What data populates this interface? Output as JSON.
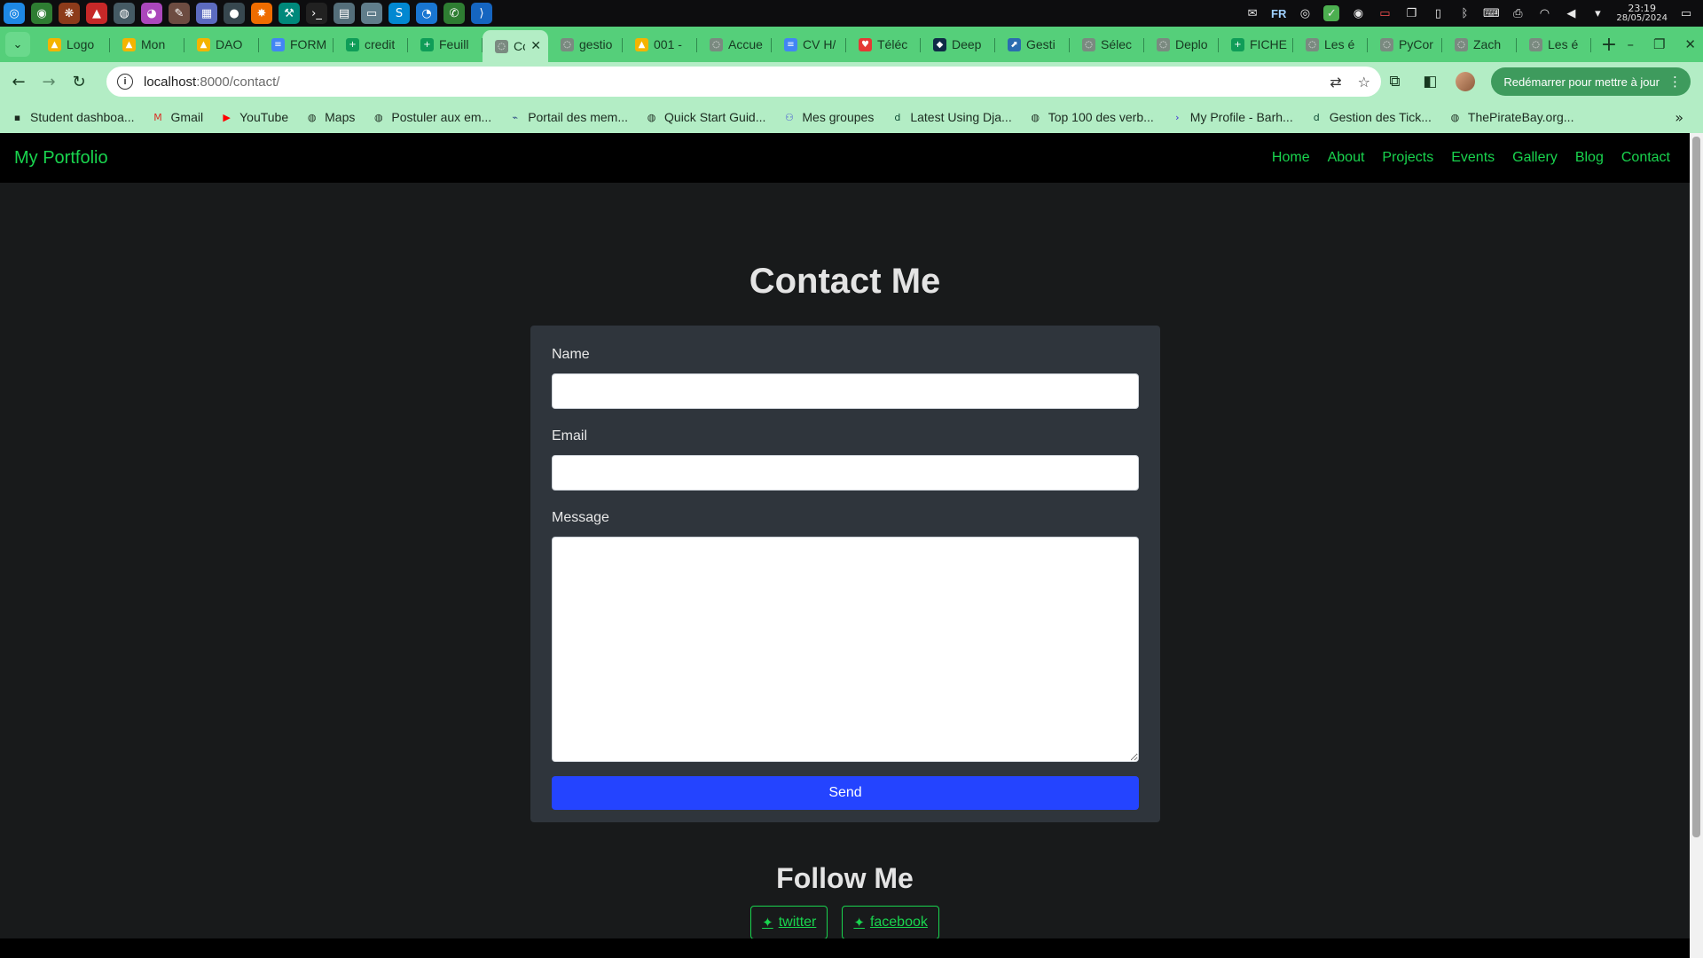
{
  "os_bar": {
    "apps": [
      {
        "name": "settings-app-icon",
        "glyph": "◎",
        "color": "#1e88e5"
      },
      {
        "name": "chrome-app-icon",
        "glyph": "◉",
        "color": "#2e7d32"
      },
      {
        "name": "leaf-app-icon",
        "glyph": "❋",
        "color": "#8d3b1a"
      },
      {
        "name": "triangle-app-icon",
        "glyph": "▲",
        "color": "#c62828"
      },
      {
        "name": "chromium-app-icon",
        "glyph": "◍",
        "color": "#455a64"
      },
      {
        "name": "color-picker-app-icon",
        "glyph": "◕",
        "color": "#ab47bc"
      },
      {
        "name": "gimp-app-icon",
        "glyph": "✎",
        "color": "#6d4c41"
      },
      {
        "name": "calculator-app-icon",
        "glyph": "▦",
        "color": "#5c6bc0"
      },
      {
        "name": "disc-app-icon",
        "glyph": "●",
        "color": "#37474f"
      },
      {
        "name": "pinwheel-app-icon",
        "glyph": "✸",
        "color": "#ef6c00"
      },
      {
        "name": "tools-app-icon",
        "glyph": "⚒",
        "color": "#00897b"
      },
      {
        "name": "terminal-app-icon",
        "glyph": "›_",
        "color": "#212121"
      },
      {
        "name": "system-monitor-app-icon",
        "glyph": "▤",
        "color": "#546e7a"
      },
      {
        "name": "files-app-icon",
        "glyph": "▭",
        "color": "#607d8b"
      },
      {
        "name": "skype-app-icon",
        "glyph": "S",
        "color": "#0288d1"
      },
      {
        "name": "messenger-app-icon",
        "glyph": "◔",
        "color": "#1976d2"
      },
      {
        "name": "whatsapp-app-icon",
        "glyph": "✆",
        "color": "#2e7d32"
      },
      {
        "name": "vscode-app-icon",
        "glyph": "⟩",
        "color": "#1565c0"
      }
    ],
    "tray": {
      "lang": "FR",
      "time": "23:19",
      "date": "28/05/2024"
    }
  },
  "tabs": [
    {
      "title": "Logo",
      "icon": "google-drive-icon",
      "color": "#f4b400",
      "glyph": "▲"
    },
    {
      "title": "Mon",
      "icon": "google-drive-icon",
      "color": "#f4b400",
      "glyph": "▲"
    },
    {
      "title": "DAO",
      "icon": "google-drive-icon",
      "color": "#f4b400",
      "glyph": "▲"
    },
    {
      "title": "FORM",
      "icon": "google-docs-icon",
      "color": "#4285f4",
      "glyph": "≡"
    },
    {
      "title": "credit",
      "icon": "google-sheets-icon",
      "color": "#0f9d58",
      "glyph": "+"
    },
    {
      "title": "Feuill",
      "icon": "google-sheets-icon",
      "color": "#0f9d58",
      "glyph": "+"
    },
    {
      "title": "Co",
      "icon": "globe-icon",
      "color": "#7a8a80",
      "glyph": "◌",
      "active": true
    },
    {
      "title": "gestio",
      "icon": "globe-icon",
      "color": "#7a8a80",
      "glyph": "◌"
    },
    {
      "title": "001 -",
      "icon": "google-drive-icon",
      "color": "#f4b400",
      "glyph": "▲"
    },
    {
      "title": "Accue",
      "icon": "globe-icon",
      "color": "#7a8a80",
      "glyph": "◌"
    },
    {
      "title": "CV H/",
      "icon": "google-docs-icon",
      "color": "#4285f4",
      "glyph": "≡"
    },
    {
      "title": "Téléc",
      "icon": "heart-icon",
      "color": "#e53935",
      "glyph": "♥"
    },
    {
      "title": "Deep",
      "icon": "deepl-icon",
      "color": "#0f2b46",
      "glyph": "◆"
    },
    {
      "title": "Gesti",
      "icon": "link-icon",
      "color": "#2b6cb0",
      "glyph": "⬈"
    },
    {
      "title": "Sélec",
      "icon": "globe-icon",
      "color": "#7a8a80",
      "glyph": "◌"
    },
    {
      "title": "Deplo",
      "icon": "globe-icon",
      "color": "#7a8a80",
      "glyph": "◌"
    },
    {
      "title": "FICHE",
      "icon": "google-sheets-icon",
      "color": "#0f9d58",
      "glyph": "+"
    },
    {
      "title": "Les é",
      "icon": "globe-icon",
      "color": "#7a8a80",
      "glyph": "◌"
    },
    {
      "title": "PyCor",
      "icon": "globe-icon",
      "color": "#7a8a80",
      "glyph": "◌"
    },
    {
      "title": "Zach",
      "icon": "globe-icon",
      "color": "#7a8a80",
      "glyph": "◌"
    },
    {
      "title": "Les é",
      "icon": "globe-icon",
      "color": "#7a8a80",
      "glyph": "◌"
    }
  ],
  "toolbar": {
    "url_host": "localhost",
    "url_rest": ":8000/contact/",
    "update_label": "Redémarrer pour mettre à jour"
  },
  "bookmarks": [
    {
      "label": "Student dashboa...",
      "icon": "alx-icon",
      "glyph": "▪",
      "color": "#1c2b20"
    },
    {
      "label": "Gmail",
      "icon": "gmail-icon",
      "glyph": "M",
      "color": "#d93025"
    },
    {
      "label": "YouTube",
      "icon": "youtube-icon",
      "glyph": "▶",
      "color": "#ff0000"
    },
    {
      "label": "Maps",
      "icon": "globe-icon",
      "glyph": "◍",
      "color": "#1c2b20"
    },
    {
      "label": "Postuler aux em...",
      "icon": "globe-icon",
      "glyph": "◍",
      "color": "#1c2b20"
    },
    {
      "label": "Portail des mem...",
      "icon": "portal-icon",
      "glyph": "⌁",
      "color": "#3a5a8c"
    },
    {
      "label": "Quick Start Guid...",
      "icon": "globe-icon",
      "glyph": "◍",
      "color": "#1c2b20"
    },
    {
      "label": "Mes groupes",
      "icon": "groups-icon",
      "glyph": "⚇",
      "color": "#4a5bd4"
    },
    {
      "label": "Latest Using Dja...",
      "icon": "django-icon",
      "glyph": "d",
      "color": "#0c4b33"
    },
    {
      "label": "Top 100 des verb...",
      "icon": "globe-icon",
      "glyph": "◍",
      "color": "#1c2b20"
    },
    {
      "label": "My Profile - Barh...",
      "icon": "profile-arrow-icon",
      "glyph": "›",
      "color": "#3b2bd4"
    },
    {
      "label": "Gestion des Tick...",
      "icon": "django-icon",
      "glyph": "d",
      "color": "#0c4b33"
    },
    {
      "label": "ThePirateBay.org...",
      "icon": "globe-icon",
      "glyph": "◍",
      "color": "#1c2b20"
    }
  ],
  "site": {
    "brand": "My Portfolio",
    "nav": [
      "Home",
      "About",
      "Projects",
      "Events",
      "Gallery",
      "Blog",
      "Contact"
    ],
    "accent": "#19d44e",
    "page_title": "Contact Me",
    "form": {
      "name_label": "Name",
      "name_value": "",
      "email_label": "Email",
      "email_value": "",
      "message_label": "Message",
      "message_value": "",
      "submit_label": "Send",
      "submit_color": "#2444ff"
    },
    "follow_title": "Follow Me",
    "social": [
      {
        "label": "twitter",
        "icon": "twitter-icon"
      },
      {
        "label": "facebook",
        "icon": "twitter-icon"
      }
    ]
  }
}
